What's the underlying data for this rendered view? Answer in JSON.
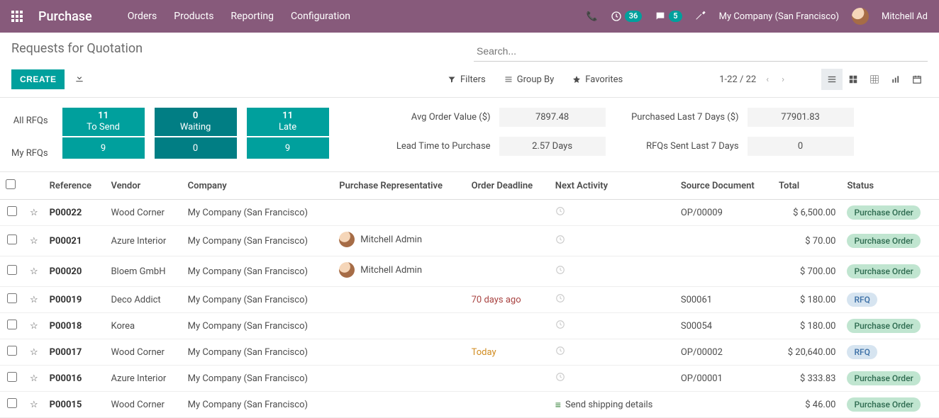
{
  "topbar": {
    "brand": "Purchase",
    "nav": [
      "Orders",
      "Products",
      "Reporting",
      "Configuration"
    ],
    "clock_badge": "36",
    "chat_badge": "5",
    "company": "My Company (San Francisco)",
    "user": "Mitchell Ad"
  },
  "breadcrumb": "Requests for Quotation",
  "search_placeholder": "Search...",
  "buttons": {
    "create": "CREATE"
  },
  "filters": {
    "filters": "Filters",
    "groupby": "Group By",
    "favorites": "Favorites"
  },
  "pager": "1-22 / 22",
  "dashboard": {
    "row_labels": [
      "All RFQs",
      "My RFQs"
    ],
    "tiles": [
      {
        "label": "To Send",
        "top": "11",
        "bottom": "9",
        "dark": false
      },
      {
        "label": "Waiting",
        "top": "0",
        "bottom": "0",
        "dark": true
      },
      {
        "label": "Late",
        "top": "11",
        "bottom": "9",
        "dark": false
      }
    ],
    "metrics_left": [
      {
        "label": "Avg Order Value ($)",
        "value": "7897.48"
      },
      {
        "label": "Lead Time to Purchase",
        "value": "2.57  Days"
      }
    ],
    "metrics_right": [
      {
        "label": "Purchased Last 7 Days ($)",
        "value": "77901.83"
      },
      {
        "label": "RFQs Sent Last 7 Days",
        "value": "0"
      }
    ]
  },
  "columns": [
    "Reference",
    "Vendor",
    "Company",
    "Purchase Representative",
    "Order Deadline",
    "Next Activity",
    "Source Document",
    "Total",
    "Status"
  ],
  "rows": [
    {
      "ref": "P00022",
      "vendor": "Wood Corner",
      "company": "My Company (San Francisco)",
      "rep": "",
      "deadline": "",
      "deadline_class": "",
      "activity": "clock",
      "source": "OP/00009",
      "total": "$ 6,500.00",
      "status": "Purchase Order",
      "status_class": "green2"
    },
    {
      "ref": "P00021",
      "vendor": "Azure Interior",
      "company": "My Company (San Francisco)",
      "rep": "Mitchell Admin",
      "deadline": "",
      "deadline_class": "",
      "activity": "clock",
      "source": "",
      "total": "$ 70.00",
      "status": "Purchase Order",
      "status_class": "green2"
    },
    {
      "ref": "P00020",
      "vendor": "Bloem GmbH",
      "company": "My Company (San Francisco)",
      "rep": "Mitchell Admin",
      "deadline": "",
      "deadline_class": "",
      "activity": "clock",
      "source": "",
      "total": "$ 700.00",
      "status": "Purchase Order",
      "status_class": "green2"
    },
    {
      "ref": "P00019",
      "vendor": "Deco Addict",
      "company": "My Company (San Francisco)",
      "rep": "",
      "deadline": "70 days ago",
      "deadline_class": "deadline-red",
      "activity": "clock",
      "source": "S00061",
      "total": "$ 180.00",
      "status": "RFQ",
      "status_class": "blue"
    },
    {
      "ref": "P00018",
      "vendor": "Korea",
      "company": "My Company (San Francisco)",
      "rep": "",
      "deadline": "",
      "deadline_class": "",
      "activity": "clock",
      "source": "S00054",
      "total": "$ 180.00",
      "status": "Purchase Order",
      "status_class": "green2"
    },
    {
      "ref": "P00017",
      "vendor": "Wood Corner",
      "company": "My Company (San Francisco)",
      "rep": "",
      "deadline": "Today",
      "deadline_class": "deadline-orange",
      "activity": "clock",
      "source": "OP/00002",
      "total": "$ 20,640.00",
      "status": "RFQ",
      "status_class": "blue"
    },
    {
      "ref": "P00016",
      "vendor": "Azure Interior",
      "company": "My Company (San Francisco)",
      "rep": "",
      "deadline": "",
      "deadline_class": "",
      "activity": "clock",
      "source": "OP/00001",
      "total": "$ 333.83",
      "status": "Purchase Order",
      "status_class": "green2"
    },
    {
      "ref": "P00015",
      "vendor": "Wood Corner",
      "company": "My Company (San Francisco)",
      "rep": "",
      "deadline": "",
      "deadline_class": "",
      "activity": "text",
      "activity_text": "Send shipping details",
      "source": "",
      "total": "$ 46.00",
      "status": "Purchase Order",
      "status_class": "green2"
    }
  ]
}
